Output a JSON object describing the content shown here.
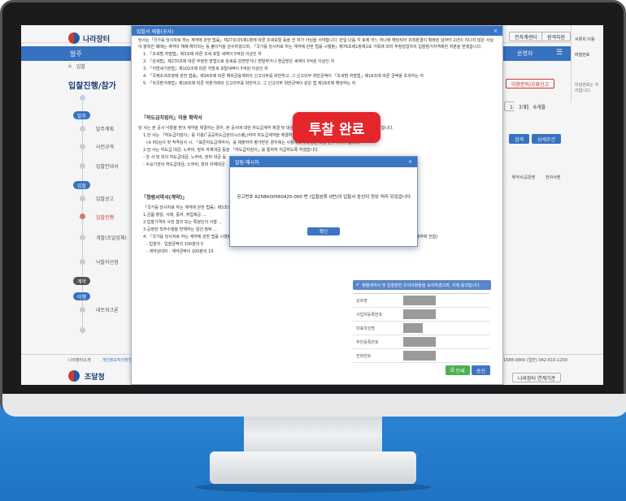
{
  "portal": {
    "logo_text": "나라장터",
    "nav_left_label": "발주",
    "nav_right_label": "운영자",
    "crumb_home": "⌂",
    "crumb_item": "입찰",
    "sidebar_title": "입찰진행/참가",
    "top_right_buttons": [
      "전자계센터",
      "원격지원"
    ],
    "filter_buttons": [
      "이용문의/오류신고"
    ],
    "search_buttons": [
      "검색",
      "상세조건"
    ],
    "period_buttons": [
      "1개월",
      "3개월",
      "6개월"
    ],
    "table_headers": [
      "계약서/공문명",
      "전자서명"
    ],
    "right_panel": [
      "서류치 이용",
      "비밀번호",
      "비밀번호는 처리합니다."
    ],
    "timeline": [
      {
        "type": "pill",
        "label": "발주"
      },
      {
        "type": "step",
        "label": "발주계획"
      },
      {
        "type": "step",
        "label": "사전규격"
      },
      {
        "type": "step",
        "label": "입찰안내서"
      },
      {
        "type": "pill",
        "label": "입찰"
      },
      {
        "type": "step",
        "label": "입찰공고"
      },
      {
        "type": "step",
        "label": "입찰진행",
        "active": true
      },
      {
        "type": "step",
        "label": "개찰(조달업체)"
      },
      {
        "type": "step",
        "label": "낙찰자선정"
      },
      {
        "type": "pill",
        "label": "계약",
        "dark": true
      },
      {
        "type": "pill",
        "label": "이행"
      },
      {
        "type": "step",
        "label": "네트워크론"
      }
    ],
    "footer_links": [
      "나라장터소개",
      "개인정보처리방침"
    ],
    "footer_phone": "1588-0800 (일반) 042-610-1200",
    "footer_brand": "조달청",
    "footer_related": "나라장터 연계기관"
  },
  "dialog": {
    "title": "입찰서 제출(공사)",
    "close": "×",
    "paragraphs": [
      "당사는「국가를 당사자로 하는 계약에 관한 법률」제27조의5제1항에 따른 조세포탈 등을 한 자가 아님을 서약합니다. 만일 다음 각 호에 어느 하나에 해당되어 유죄판결이 확정된 날부터 2년이 지나지 않은 사실이 밝혀진 때에는 계약의 해제·해지되는 등 불이익을 감수하겠으며, 「국가를 당사자로 하는 계약에 관한 법률 시행령」제76조제1항제1호 가목에 따라 부정당업자의 입찰참가자격제한 처분을 받겠습니다.",
      "1. 「조세범 처벌법」제3조에 따른 조세 포탈 세액이 5억원 이상인 자",
      "2. 「관세법」제270조에 따른 부정한 방법으로 관세를 감면받거나 면탈하거나 환급받은 세액이 5억원 이상인 자",
      "3. 「지방세기본법」제102조에 따른 지방세 포탈세액이 5억원 이상인 자",
      "4. 「국제조세조정에 관한 법률」제34조에 따른 해외금융계좌의 신고의무를 위반하고, 그 신고의무 위반금액이 「조세범 처벌법」제16조에 따른 금액을 초과하는 자",
      "5. 「외국환거래법」제18조에 따른 자본거래의 신고의무를 위반하고, 그 신고의무 위반금액이 같은 법 제29조에 해당하는 자"
    ],
    "section_subcontract": "「하도급지킴이」이용 확약서",
    "subcontract_lines": [
      "당 사는 본 공사 낙찰을 받아 계약을 체결하는 경우, 본 공사에 대한 하도급계약 체결 및 대금지급에 관하여 아래 사항을 성실히 이행할 것을 확약합니다.",
      "1.당 사는 「하도급지킴이」를 이용(「공공하도급관리시스템」)하여 하도급계약을 체결하고 하도급대금 등을 지급하도록 하겠습니다.",
      "(※ PQ심사 및 적격심사 시, 「표준하도급계약서」를 제출하여 평가받은 경우에는 사용계획서에 정한 바를 준수하여야 합니다)",
      "2.당 사는 하도급 대금, 노무비, 장비 자재대금 등을 「하도급지킴이」를 통하여 지급하도록 하겠습니다.",
      "- 당 사 및 위의 하도급대금, 노무비, 장비 대금 등",
      "- 수요기관의 하도급대금, 노무비, 장비 자재대금"
    ],
    "section_integrity": "「청렴서약서(계약)」",
    "integrity_lines": [
      "「국가를 당사자로 하는 계약에 관한 법률」제5조의2에 따라 입찰자 또는 계약상대자는 입찰, 낙찰, 계약체결 및 이행, 감독, 검사 등에 관하여 ...",
      "1.금품·향응, 사례, 증여, 취업제공 ...",
      "2.입찰가격의 사전 협의 또는 특정인의 낙찰 ...",
      "3.공정한 직무수행을 방해하는 알선·청탁 ...",
      "4. 「국가를 당사자로 하는 계약에 관한 법률 시행령」제4조의2제1항제2호 위반 시에 따라 손해배상액을 납부토록 하겠습니다.(국가계약법 적용 조달청 입찰 및 계약에 한함)",
      "- 입찰자 : 입찰금액의 100분의 5",
      "- 계약상대자 : 계약금액의 100분의 10"
    ],
    "agree_label": "청렴계약서 및 입찰관련 유의사항들을 숙지하였으며, 이에 동의합니다.",
    "form_labels": [
      "상호명",
      "사업자등록번호",
      "대표자성명",
      "주민등록번호",
      "전화번호"
    ],
    "print_label": "인쇄",
    "send_label": "송신"
  },
  "overlay_badge": "투찰 완료",
  "alert": {
    "title": "알림 메시지",
    "close": "×",
    "message": "공고번호 R25BK00560425-000 번 (입찰분류 0번)의 입찰서 송신이 정상 처리 되었습니다.",
    "ok_label": "확인"
  },
  "colors": {
    "primary": "#3c76c3",
    "badge": "#e4262d",
    "floor": "#1e73c4"
  }
}
